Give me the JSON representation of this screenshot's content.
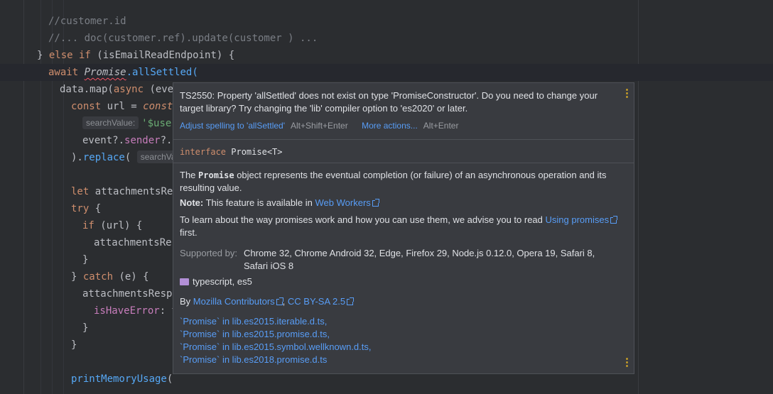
{
  "code": {
    "line1": "//customer.id",
    "line2": "//... doc(customer.ref).update(customer ) ...",
    "line3_a": "} ",
    "line3_else": "else if",
    "line3_b": " (",
    "line3_var": "isEmailReadEndpoint",
    "line3_c": ") {",
    "line4_await": "await",
    "line4_promise": "Promise",
    "line4_fn": ".allSettled(",
    "line5_a": "data.map(",
    "line5_async": "async",
    "line5_b": " (even",
    "line6_const": "const",
    "line6_b": " url = ",
    "line6_c": "consta",
    "line7_hint": "searchValue:",
    "line7_str": "'$use",
    "line8_a": "event?.",
    "line8_prop": "sender",
    "line8_b": "?.e",
    "line9_a": ").",
    "line9_fn": "replace",
    "line9_b": "( ",
    "line9_hint": "searchVal",
    "line11_let": "let",
    "line11_b": " attachmentsRes",
    "line12_try": "try",
    "line12_b": " {",
    "line13_if": "if",
    "line13_b": " (url) {",
    "line14": "attachmentsRes",
    "line15": "}",
    "line16_a": "} ",
    "line16_catch": "catch",
    "line16_b": " (e) {",
    "line17": "attachmentsRespo",
    "line18_prop": "isHaveError",
    "line18_b": ": t",
    "line19": "}",
    "line20": "}",
    "line22_fn": "printMemoryUsage",
    "line22_b": "("
  },
  "popup": {
    "error_text": "TS2550: Property 'allSettled' does not exist on type 'PromiseConstructor'. Do you need to change your target library? Try changing the 'lib' compiler option to 'es2020' or later.",
    "action1_label": "Adjust spelling to 'allSettled'",
    "action1_shortcut": "Alt+Shift+Enter",
    "action2_label": "More actions...",
    "action2_shortcut": "Alt+Enter",
    "menu_icon": "⋮",
    "signature_kw": "interface",
    "signature_name": " Promise<T>",
    "doc_p1_a": "The ",
    "doc_p1_code": "Promise",
    "doc_p1_b": " object represents the eventual completion (or failure) of an asynchronous operation and its resulting value.",
    "note_label": "Note:",
    "note_text": " This feature is available in ",
    "note_link": "Web Workers",
    "learn_a": "To learn about the way promises work and how you can use them, we advise you to read ",
    "learn_link": "Using promises",
    "learn_b": " first.",
    "supported_label": "Supported by:",
    "supported_value": "Chrome 32, Chrome Android 32, Edge, Firefox 29, Node.js 0.12.0, Opera 19, Safari 8, Safari iOS 8",
    "lib_text": "typescript, es5",
    "by_label": "By ",
    "contrib_link": "Mozilla Contributors",
    "comma": ", ",
    "license_link": "CC BY-SA 2.5",
    "refs": [
      "`Promise` in lib.es2015.iterable.d.ts,",
      "`Promise` in lib.es2015.promise.d.ts,",
      "`Promise` in lib.es2015.symbol.wellknown.d.ts,",
      "`Promise` in lib.es2018.promise.d.ts"
    ]
  },
  "colors": {
    "background": "#2b2d30",
    "keyword": "#cf8e6d",
    "function": "#56a8f5",
    "property": "#c77dbb",
    "string": "#6aab73",
    "link": "#589df6",
    "menu_icon": "#e6b422"
  }
}
